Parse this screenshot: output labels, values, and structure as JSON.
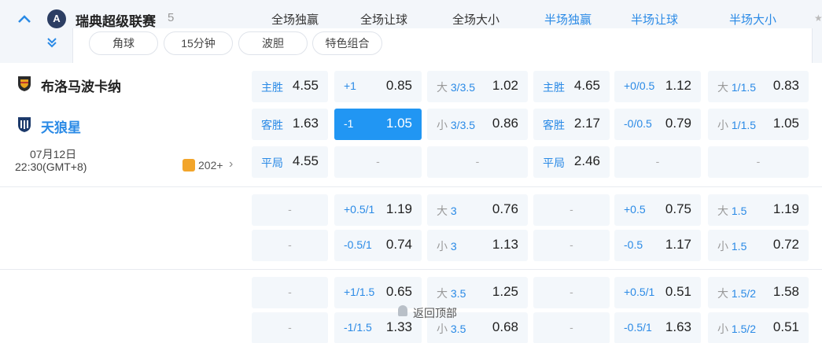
{
  "league": {
    "name": "瑞典超级联赛",
    "count": "5",
    "columns": [
      "全场独赢",
      "全场让球",
      "全场大小",
      "半场独赢",
      "半场让球",
      "半场大小"
    ],
    "filters": [
      "角球",
      "15分钟",
      "波胆",
      "特色组合"
    ]
  },
  "match": {
    "home": "布洛马波卡纳",
    "away": "天狼星",
    "date": "07月12日",
    "time": "22:30(GMT+8)",
    "more": "202+",
    "more_arrow": "›"
  },
  "rows": [
    [
      {
        "lbl": "主胜",
        "val": "4.55"
      },
      {
        "lbl": "+1",
        "val": "0.85"
      },
      {
        "pre": "大",
        "lbl": "3/3.5",
        "val": "1.02"
      },
      {
        "lbl": "主胜",
        "val": "4.65"
      },
      {
        "lbl": "+0/0.5",
        "val": "1.12"
      },
      {
        "pre": "大",
        "lbl": "1/1.5",
        "val": "0.83"
      }
    ],
    [
      {
        "lbl": "客胜",
        "val": "1.63"
      },
      {
        "lbl": "-1",
        "val": "1.05",
        "active": true
      },
      {
        "pre": "小",
        "lbl": "3/3.5",
        "val": "0.86"
      },
      {
        "lbl": "客胜",
        "val": "2.17"
      },
      {
        "lbl": "-0/0.5",
        "val": "0.79"
      },
      {
        "pre": "小",
        "lbl": "1/1.5",
        "val": "1.05"
      }
    ],
    [
      {
        "lbl": "平局",
        "val": "4.55"
      },
      {
        "dash": "-"
      },
      {
        "dash": "-"
      },
      {
        "lbl": "平局",
        "val": "2.46"
      },
      {
        "dash": "-"
      },
      {
        "dash": "-"
      }
    ],
    [
      {
        "dash": "-"
      },
      {
        "lbl": "+0.5/1",
        "val": "1.19"
      },
      {
        "pre": "大",
        "lbl": "3",
        "val": "0.76"
      },
      {
        "dash": "-"
      },
      {
        "lbl": "+0.5",
        "val": "0.75"
      },
      {
        "pre": "大",
        "lbl": "1.5",
        "val": "1.19"
      }
    ],
    [
      {
        "dash": "-"
      },
      {
        "lbl": "-0.5/1",
        "val": "0.74"
      },
      {
        "pre": "小",
        "lbl": "3",
        "val": "1.13"
      },
      {
        "dash": "-"
      },
      {
        "lbl": "-0.5",
        "val": "1.17"
      },
      {
        "pre": "小",
        "lbl": "1.5",
        "val": "0.72"
      }
    ],
    [
      {
        "dash": "-"
      },
      {
        "lbl": "+1/1.5",
        "val": "0.65"
      },
      {
        "pre": "大",
        "lbl": "3.5",
        "val": "1.25"
      },
      {
        "dash": "-"
      },
      {
        "lbl": "+0.5/1",
        "val": "0.51"
      },
      {
        "pre": "大",
        "lbl": "1.5/2",
        "val": "1.58"
      }
    ],
    [
      {
        "dash": "-"
      },
      {
        "lbl": "-1/1.5",
        "val": "1.33"
      },
      {
        "pre": "小",
        "lbl": "3.5",
        "val": "0.68"
      },
      {
        "dash": "-"
      },
      {
        "lbl": "-0.5/1",
        "val": "1.63"
      },
      {
        "pre": "小",
        "lbl": "1.5/2",
        "val": "0.51"
      }
    ]
  ],
  "back_to_top": "返回顶部",
  "colors": {
    "accent": "#2a8ae6",
    "active_cell": "#2196f3",
    "cell_bg": "#f3f7fb",
    "coin": "#f2a52b"
  }
}
